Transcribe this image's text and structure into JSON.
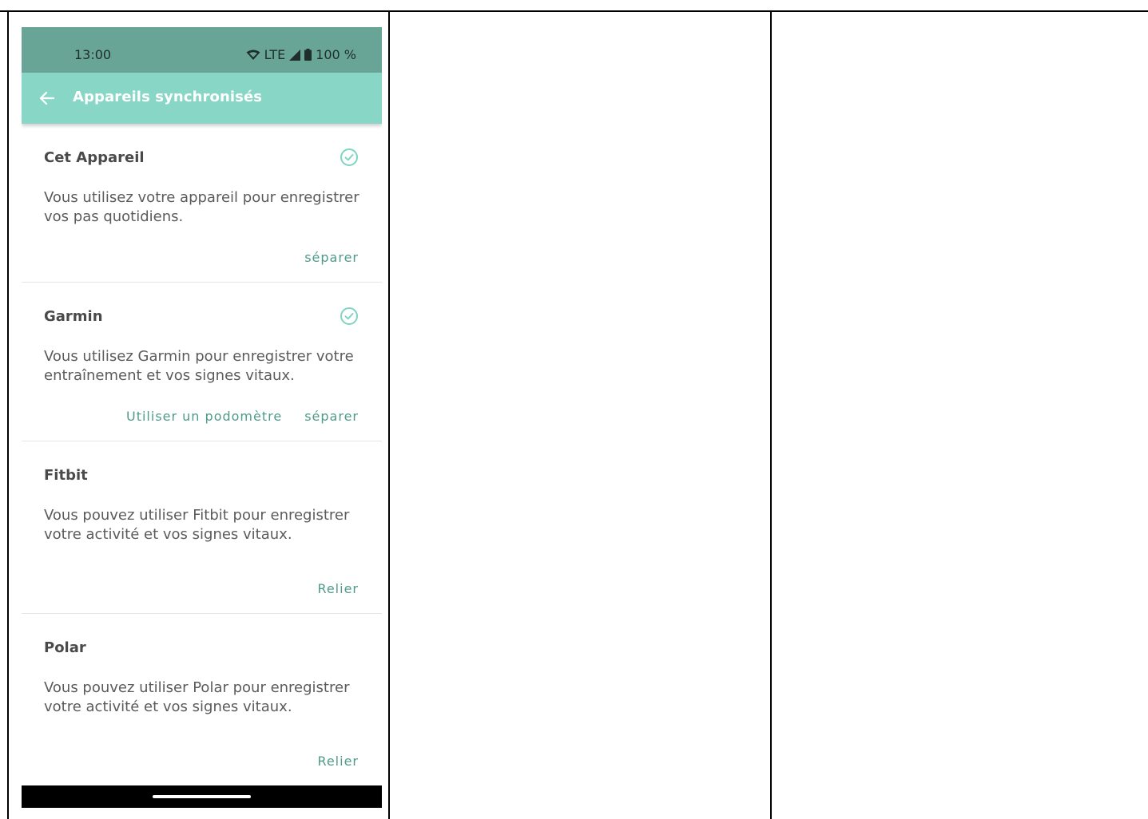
{
  "status_bar": {
    "time": "13:00",
    "network": "LTE",
    "battery": "100 %",
    "icons": [
      "wifi-icon",
      "signal-icon",
      "battery-icon"
    ]
  },
  "app_bar": {
    "back_icon": "arrow-left-icon",
    "title": "Appareils synchronisés"
  },
  "colors": {
    "status_bar_bg": "#69a597",
    "app_bar_bg": "#88d7c6",
    "accent": "#4f9b89",
    "check": "#7fd4c3"
  },
  "devices": [
    {
      "name": "Cet Appareil",
      "connected": true,
      "description": "Vous utilisez votre appareil pour enregistrer vos pas quotidiens.",
      "actions": [
        "séparer"
      ]
    },
    {
      "name": "Garmin",
      "connected": true,
      "description": "Vous utilisez Garmin pour enregistrer votre entraînement et vos signes vitaux.",
      "actions": [
        "Utiliser un podomètre",
        "séparer"
      ]
    },
    {
      "name": "Fitbit",
      "connected": false,
      "description": "Vous pouvez utiliser Fitbit pour enregistrer votre activité et vos signes vitaux.",
      "actions": [
        "Relier"
      ]
    },
    {
      "name": "Polar",
      "connected": false,
      "description": "Vous pouvez utiliser Polar pour enregistrer votre activité et vos signes vitaux.",
      "actions": [
        "Relier"
      ]
    }
  ]
}
